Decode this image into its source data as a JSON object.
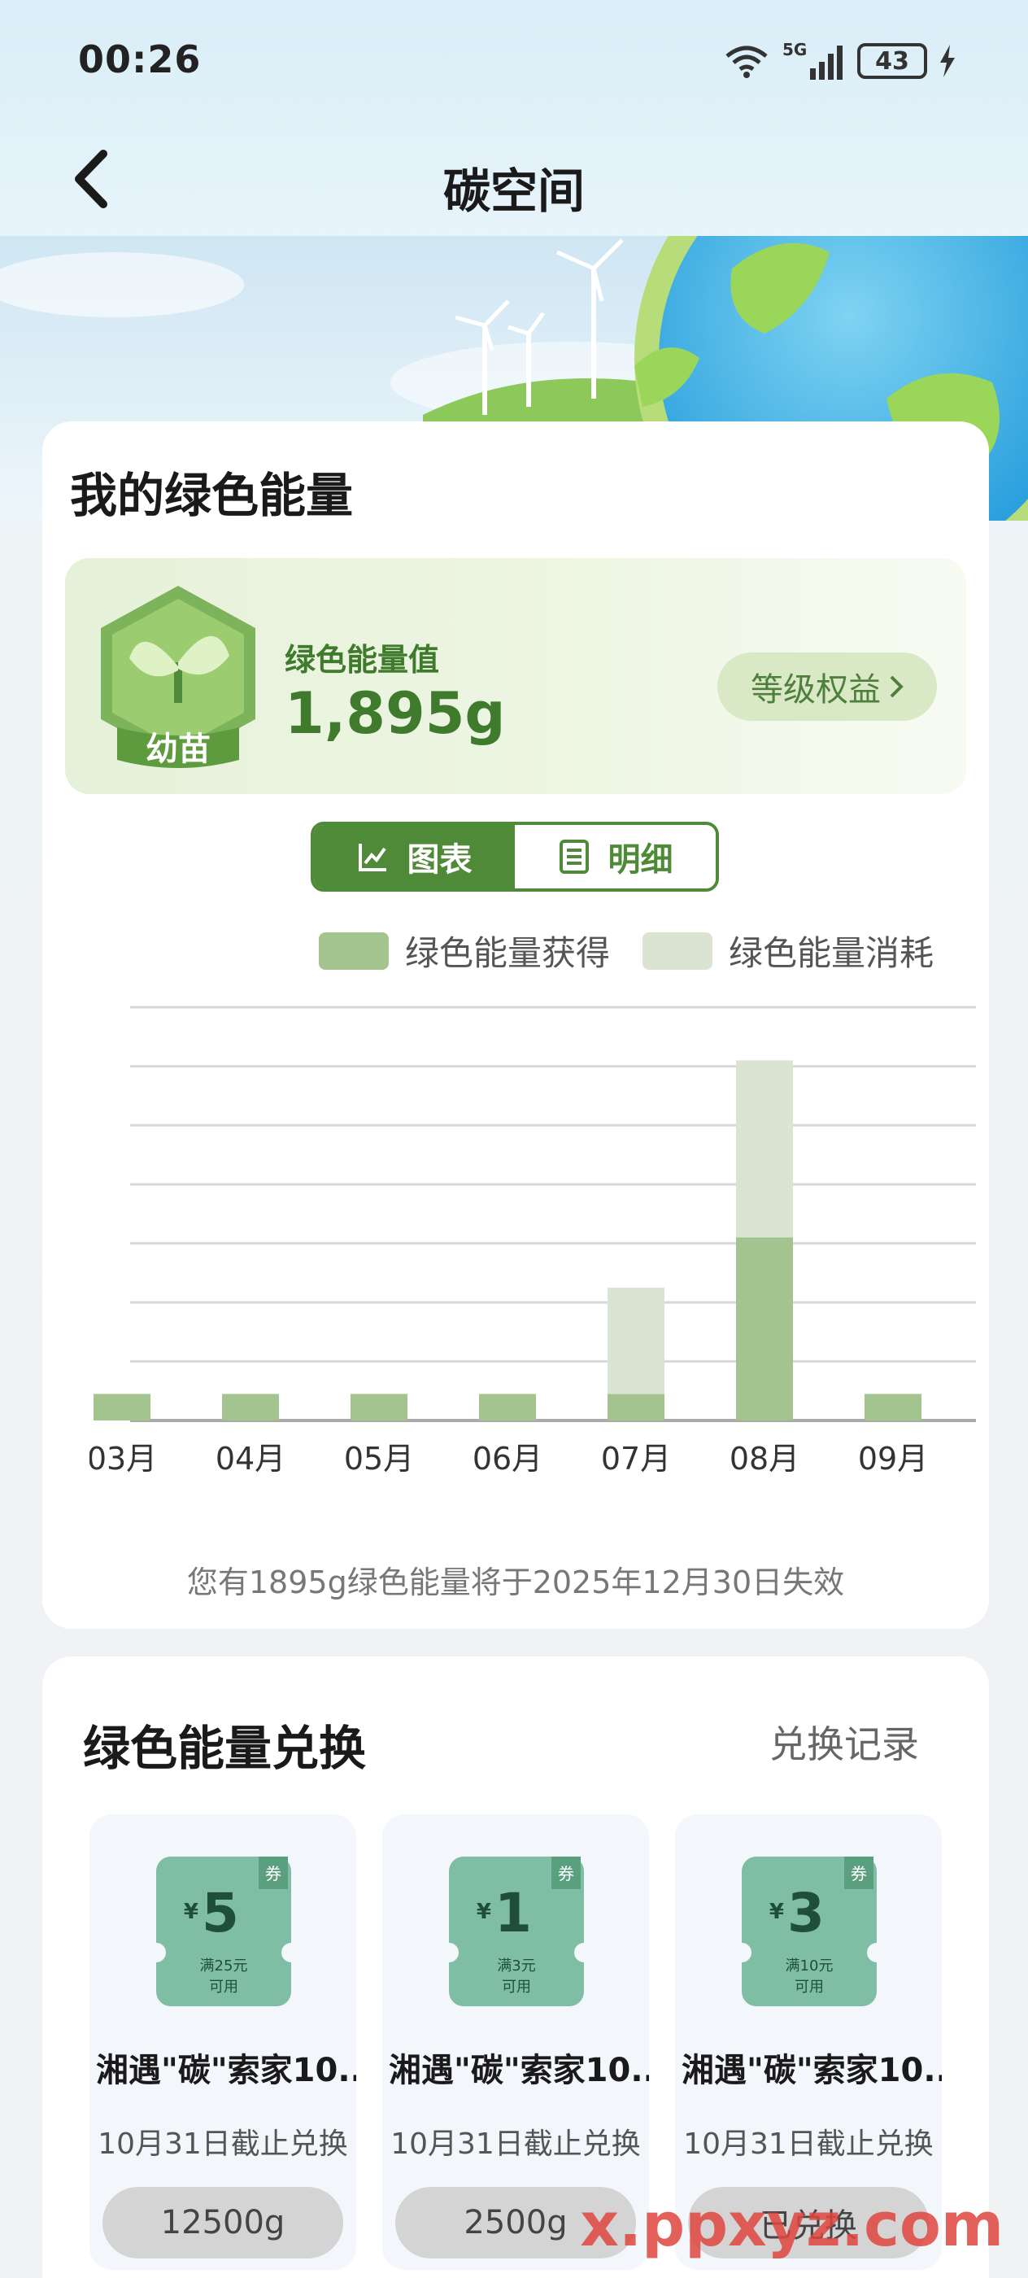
{
  "status_bar": {
    "time": "00:26",
    "network": "5G",
    "battery": "43"
  },
  "header": {
    "title": "碳空间"
  },
  "energy": {
    "section_title": "我的绿色能量",
    "level_badge": "幼苗",
    "value_label": "绿色能量值",
    "value": "1,895g",
    "rights_button": "等级权益",
    "tabs": [
      {
        "label": "图表"
      },
      {
        "label": "明细"
      }
    ],
    "legend": [
      {
        "label": "绿色能量获得",
        "color": "#a3c48f"
      },
      {
        "label": "绿色能量消耗",
        "color": "#dbe4d2"
      }
    ],
    "expire_note": "您有1895g绿色能量将于2025年12月30日失效"
  },
  "chart_data": {
    "type": "bar",
    "categories": [
      "03月",
      "04月",
      "05月",
      "06月",
      "07月",
      "08月",
      "09月"
    ],
    "series": [
      {
        "name": "绿色能量获得",
        "values": [
          0.45,
          0.45,
          0.45,
          0.45,
          0.45,
          3.1,
          0.45
        ],
        "color": "#a3c48f"
      },
      {
        "name": "绿色能量消耗",
        "values": [
          0,
          0,
          0,
          0,
          1.8,
          3.0,
          0
        ],
        "color": "#dbe4d2"
      }
    ],
    "ylim": [
      0,
      7
    ],
    "grid": true,
    "legend_position": "top-right"
  },
  "exchange": {
    "section_title": "绿色能量兑换",
    "record_link": "兑换记录",
    "items": [
      {
        "coupon_amount": "5",
        "coupon_currency": "¥",
        "coupon_condition": "满25元",
        "coupon_usable": "可用",
        "coupon_tag": "券",
        "name": "湘遇\"碳\"索家10...",
        "deadline": "10月31日截止兑换",
        "button": "12500g"
      },
      {
        "coupon_amount": "1",
        "coupon_currency": "¥",
        "coupon_condition": "满3元",
        "coupon_usable": "可用",
        "coupon_tag": "券",
        "name": "湘遇\"碳\"索家10...",
        "deadline": "10月31日截止兑换",
        "button": "2500g"
      },
      {
        "coupon_amount": "3",
        "coupon_currency": "¥",
        "coupon_condition": "满10元",
        "coupon_usable": "可用",
        "coupon_tag": "券",
        "name": "湘遇\"碳\"索家10...",
        "deadline": "10月31日截止兑换",
        "button": "已兑换"
      }
    ]
  },
  "watermark": {
    "text": "x.ppxyz.com"
  }
}
